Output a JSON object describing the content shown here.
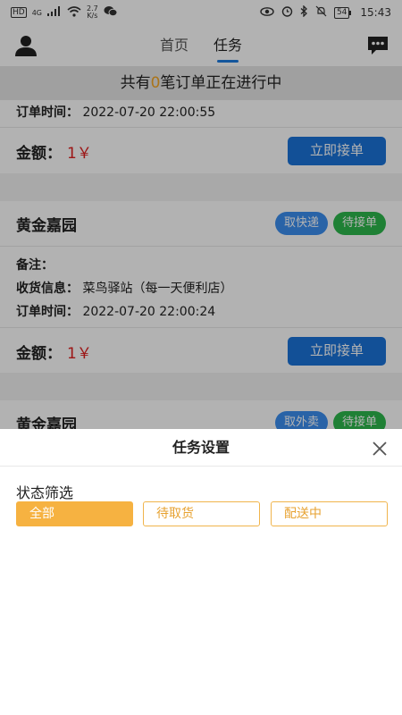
{
  "status_bar": {
    "left_hd": "HD",
    "left_net": "4G",
    "speed_top": "2.7",
    "speed_bottom": "K/s",
    "battery": "54",
    "time": "15:43"
  },
  "nav": {
    "tabs": [
      {
        "label": "首页",
        "active": false
      },
      {
        "label": "任务",
        "active": true
      }
    ]
  },
  "banner": {
    "prefix": "共有",
    "count": "0",
    "suffix": "笔订单正在进行中"
  },
  "orders": [
    {
      "time_label": "订单时间：",
      "time_value": "2022-07-20 22:00:55",
      "amount_label": "金额：",
      "amount_value": "1￥",
      "accept_label": "立即接单"
    },
    {
      "shop": "黄金嘉园",
      "tags": [
        "取快递",
        "待接单"
      ],
      "note_label": "备注：",
      "note_value": "",
      "receiver_label": "收货信息：",
      "receiver_value": "菜鸟驿站（每一天便利店）",
      "time_label": "订单时间：",
      "time_value": "2022-07-20 22:00:24",
      "amount_label": "金额：",
      "amount_value": "1￥",
      "accept_label": "立即接单"
    },
    {
      "shop": "黄金嘉园",
      "tags": [
        "取外卖",
        "待接单"
      ]
    }
  ],
  "sheet": {
    "title": "任务设置",
    "filter_label": "状态筛选",
    "options": [
      {
        "label": "全部",
        "selected": true
      },
      {
        "label": "待取货",
        "selected": false
      },
      {
        "label": "配送中",
        "selected": false
      }
    ]
  },
  "colors": {
    "accent_blue": "#1a73d9",
    "tag_blue": "#3b8ef0",
    "tag_green": "#2db84d",
    "price_red": "#e02020",
    "option_orange": "#f6b241"
  }
}
